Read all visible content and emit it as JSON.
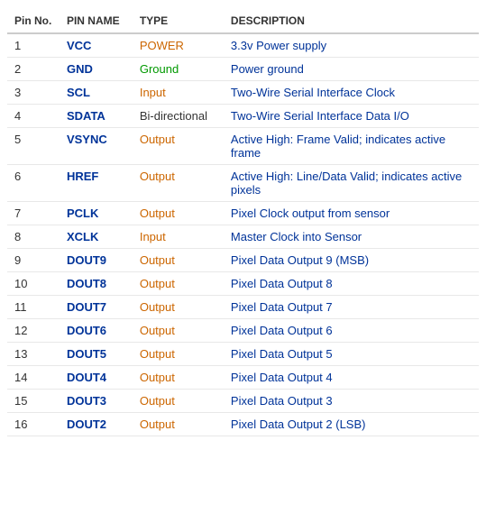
{
  "table": {
    "columns": [
      "Pin No.",
      "PIN NAME",
      "TYPE",
      "DESCRIPTION"
    ],
    "rows": [
      {
        "pin": "1",
        "name": "VCC",
        "type": "POWER",
        "type_class": "type-power",
        "description": "3.3v Power supply"
      },
      {
        "pin": "2",
        "name": "GND",
        "type": "Ground",
        "type_class": "type-ground",
        "description": "Power ground"
      },
      {
        "pin": "3",
        "name": "SCL",
        "type": "Input",
        "type_class": "type-input",
        "description": "Two-Wire Serial Interface Clock"
      },
      {
        "pin": "4",
        "name": "SDATA",
        "type": "Bi-directional",
        "type_class": "type-bidirectional",
        "description": "Two-Wire Serial Interface Data I/O"
      },
      {
        "pin": "5",
        "name": "VSYNC",
        "type": "Output",
        "type_class": "type-output",
        "description": "Active High: Frame Valid; indicates active frame"
      },
      {
        "pin": "6",
        "name": "HREF",
        "type": "Output",
        "type_class": "type-output",
        "description": "Active High: Line/Data Valid; indicates active pixels"
      },
      {
        "pin": "7",
        "name": "PCLK",
        "type": "Output",
        "type_class": "type-output",
        "description": "Pixel Clock output from sensor"
      },
      {
        "pin": "8",
        "name": "XCLK",
        "type": "Input",
        "type_class": "type-input",
        "description": "Master Clock into Sensor"
      },
      {
        "pin": "9",
        "name": "DOUT9",
        "type": "Output",
        "type_class": "type-output",
        "description": "Pixel Data Output 9 (MSB)"
      },
      {
        "pin": "10",
        "name": "DOUT8",
        "type": "Output",
        "type_class": "type-output",
        "description": "Pixel Data Output 8"
      },
      {
        "pin": "11",
        "name": "DOUT7",
        "type": "Output",
        "type_class": "type-output",
        "description": "Pixel Data Output 7"
      },
      {
        "pin": "12",
        "name": "DOUT6",
        "type": "Output",
        "type_class": "type-output",
        "description": "Pixel Data Output 6"
      },
      {
        "pin": "13",
        "name": "DOUT5",
        "type": "Output",
        "type_class": "type-output",
        "description": "Pixel Data Output 5"
      },
      {
        "pin": "14",
        "name": "DOUT4",
        "type": "Output",
        "type_class": "type-output",
        "description": "Pixel Data Output 4"
      },
      {
        "pin": "15",
        "name": "DOUT3",
        "type": "Output",
        "type_class": "type-output",
        "description": "Pixel Data Output 3"
      },
      {
        "pin": "16",
        "name": "DOUT2",
        "type": "Output",
        "type_class": "type-output",
        "description": "Pixel Data Output 2 (LSB)"
      }
    ]
  }
}
